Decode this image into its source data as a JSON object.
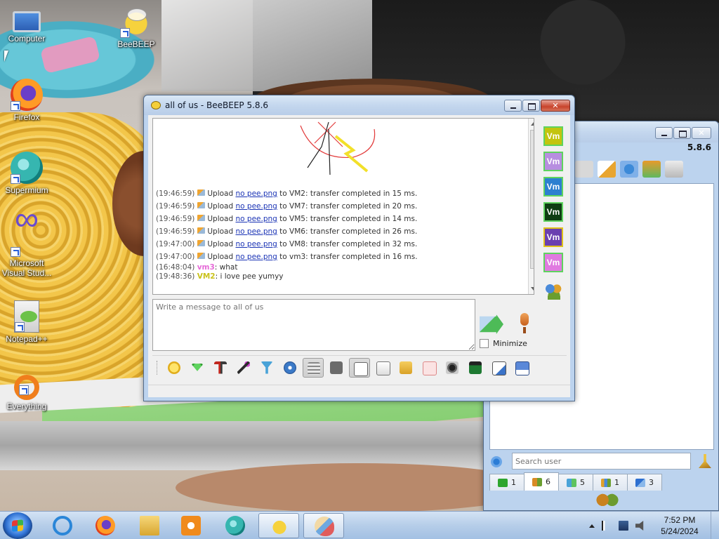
{
  "desktop": {
    "icons": [
      {
        "label": "Computer"
      },
      {
        "label": "BeeBEEP"
      },
      {
        "label": "Firefox"
      },
      {
        "label": "Supermium"
      },
      {
        "label": "Microsoft Visual Stud..."
      },
      {
        "label": "Notepad++"
      },
      {
        "label": "Everything"
      }
    ]
  },
  "bg_window": {
    "version": "5.8.6",
    "search_placeholder": "Search user",
    "tabs": [
      {
        "icon": "chat-list-icon",
        "count": "1"
      },
      {
        "icon": "users-icon",
        "count": "6"
      },
      {
        "icon": "group-chats-icon",
        "count": "5"
      },
      {
        "icon": "groups-icon",
        "count": "1"
      },
      {
        "icon": "file-transfer-icon",
        "count": "3"
      }
    ]
  },
  "chat_window": {
    "title": "all of us - BeeBEEP 5.8.6",
    "messages": [
      {
        "time": "(19:46:59)",
        "action": "Upload",
        "file": "no pee.png",
        "text": "to VM2: transfer completed in 15 ms."
      },
      {
        "time": "(19:46:59)",
        "action": "Upload",
        "file": "no pee.png",
        "text": "to VM7: transfer completed in 20 ms."
      },
      {
        "time": "(19:46:59)",
        "action": "Upload",
        "file": "no pee.png",
        "text": "to VM5: transfer completed in 14 ms."
      },
      {
        "time": "(19:46:59)",
        "action": "Upload",
        "file": "no pee.png",
        "text": "to VM6: transfer completed in 26 ms."
      },
      {
        "time": "(19:47:00)",
        "action": "Upload",
        "file": "no pee.png",
        "text": "to VM8: transfer completed in 32 ms."
      },
      {
        "time": "(19:47:00)",
        "action": "Upload",
        "file": "no pee.png",
        "text": "to vm3: transfer completed in 16 ms."
      }
    ],
    "chat": [
      {
        "time": "(16:48:04)",
        "nick": "vm3",
        "nick_color": "#e66ad8",
        "text": ": what"
      },
      {
        "time": "(19:48:36)",
        "nick": "VM2",
        "nick_color": "#c9c21a",
        "text": ": i love pee yumyy"
      }
    ],
    "composer_placeholder": "Write a message to all of us",
    "minimize_label": "Minimize",
    "avatars": [
      {
        "label": "Vm",
        "bg": "#c3c40e",
        "border": "#5fd35f"
      },
      {
        "label": "Vm",
        "bg": "#b78ee0",
        "border": "#5fd35f"
      },
      {
        "label": "Vm",
        "bg": "#2c7fd0",
        "border": "#5fd35f"
      },
      {
        "label": "Vm",
        "bg": "#0e3d13",
        "border": "#5fd35f"
      },
      {
        "label": "Vm",
        "bg": "#6a3fb0",
        "border": "#e0c21a"
      },
      {
        "label": "Vm",
        "bg": "#e07ae0",
        "border": "#5fd35f"
      }
    ]
  },
  "taskbar": {
    "time": "7:52 PM",
    "date": "5/24/2024"
  }
}
